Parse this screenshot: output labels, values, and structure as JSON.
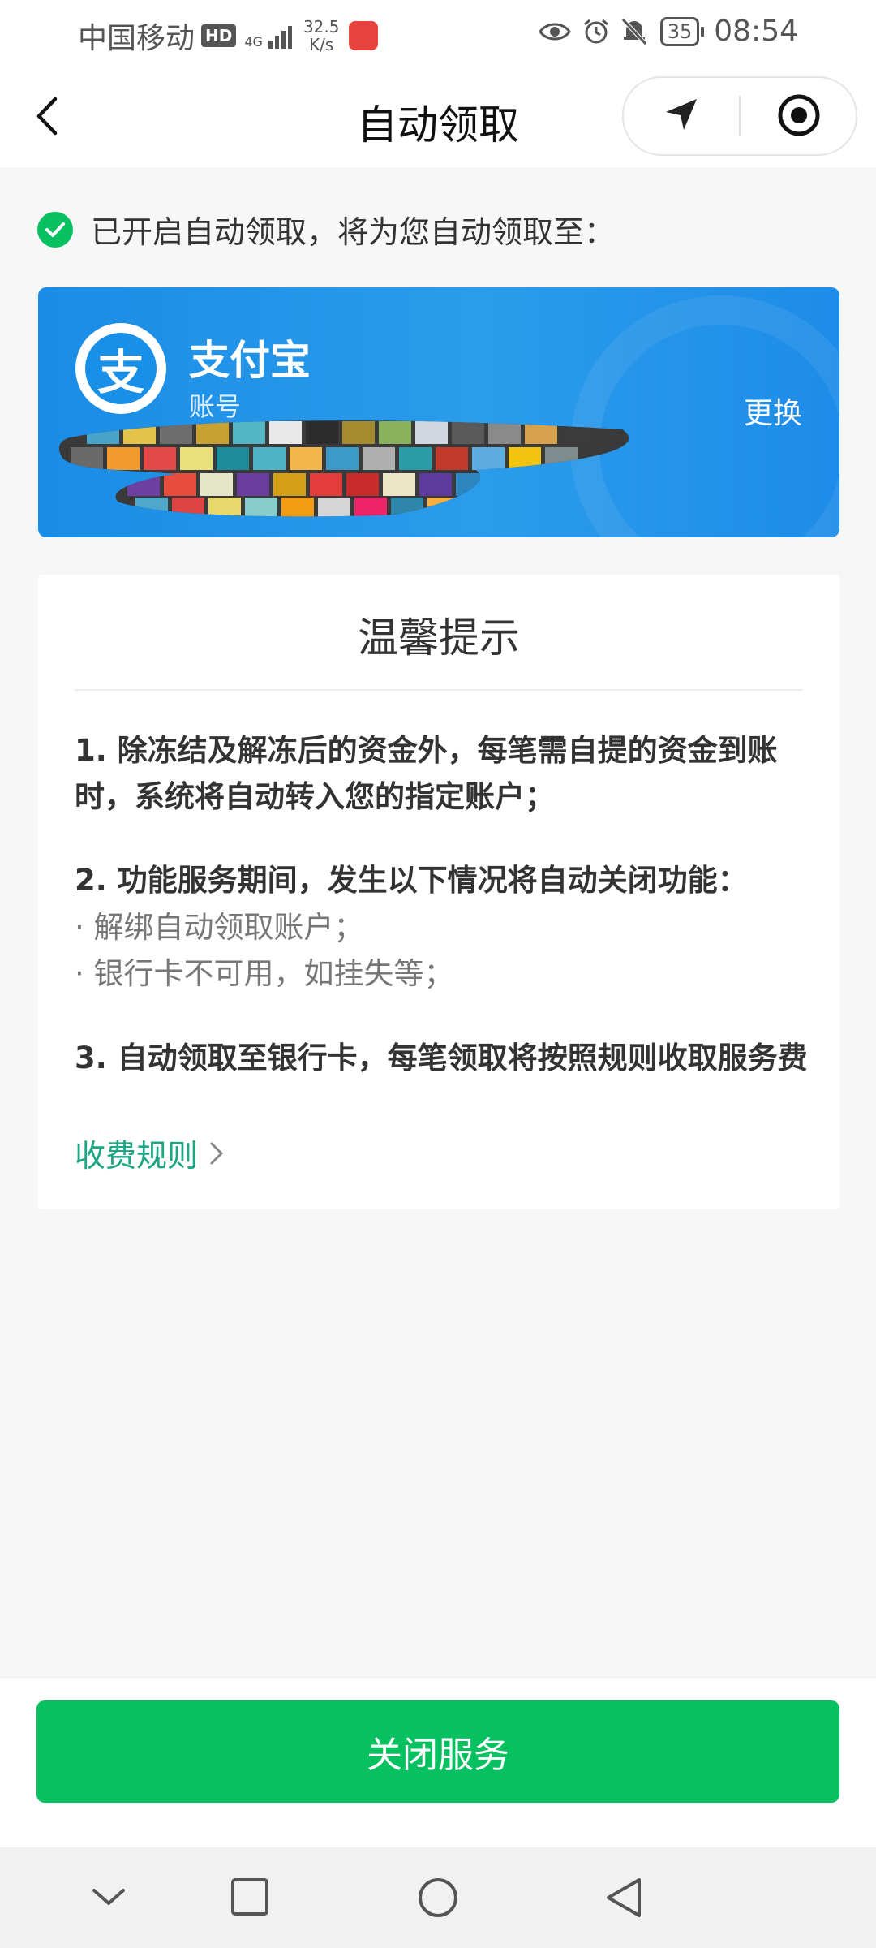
{
  "status_bar": {
    "carrier": "中国移动",
    "hd_badge": "HD",
    "network": "4G",
    "speed_value": "32.5",
    "speed_unit": "K/s",
    "battery": "35",
    "time": "08:54"
  },
  "nav": {
    "title": "自动领取"
  },
  "enabled_text": "已开启自动领取，将为您自动领取至：",
  "account_card": {
    "logo_char": "支",
    "name": "支付宝",
    "sub_label": "账号",
    "change_label": "更换"
  },
  "tips": {
    "title": "温馨提示",
    "item1": "1. 除冻结及解冻后的资金外，每笔需自提的资金到账时，系统将自动转入您的指定账户；",
    "item2": "2. 功能服务期间，发生以下情况将自动关闭功能：",
    "bullet1": "· 解绑自动领取账户；",
    "bullet2": "· 银行卡不可用，如挂失等；",
    "item3": "3. 自动领取至银行卡，每笔领取将按照规则收取服务费",
    "fee_link": "收费规则"
  },
  "close_button": "关闭服务",
  "colors": {
    "accent_green": "#07C160",
    "link_green": "#1BA784",
    "alipay_blue": "#1890E8"
  }
}
